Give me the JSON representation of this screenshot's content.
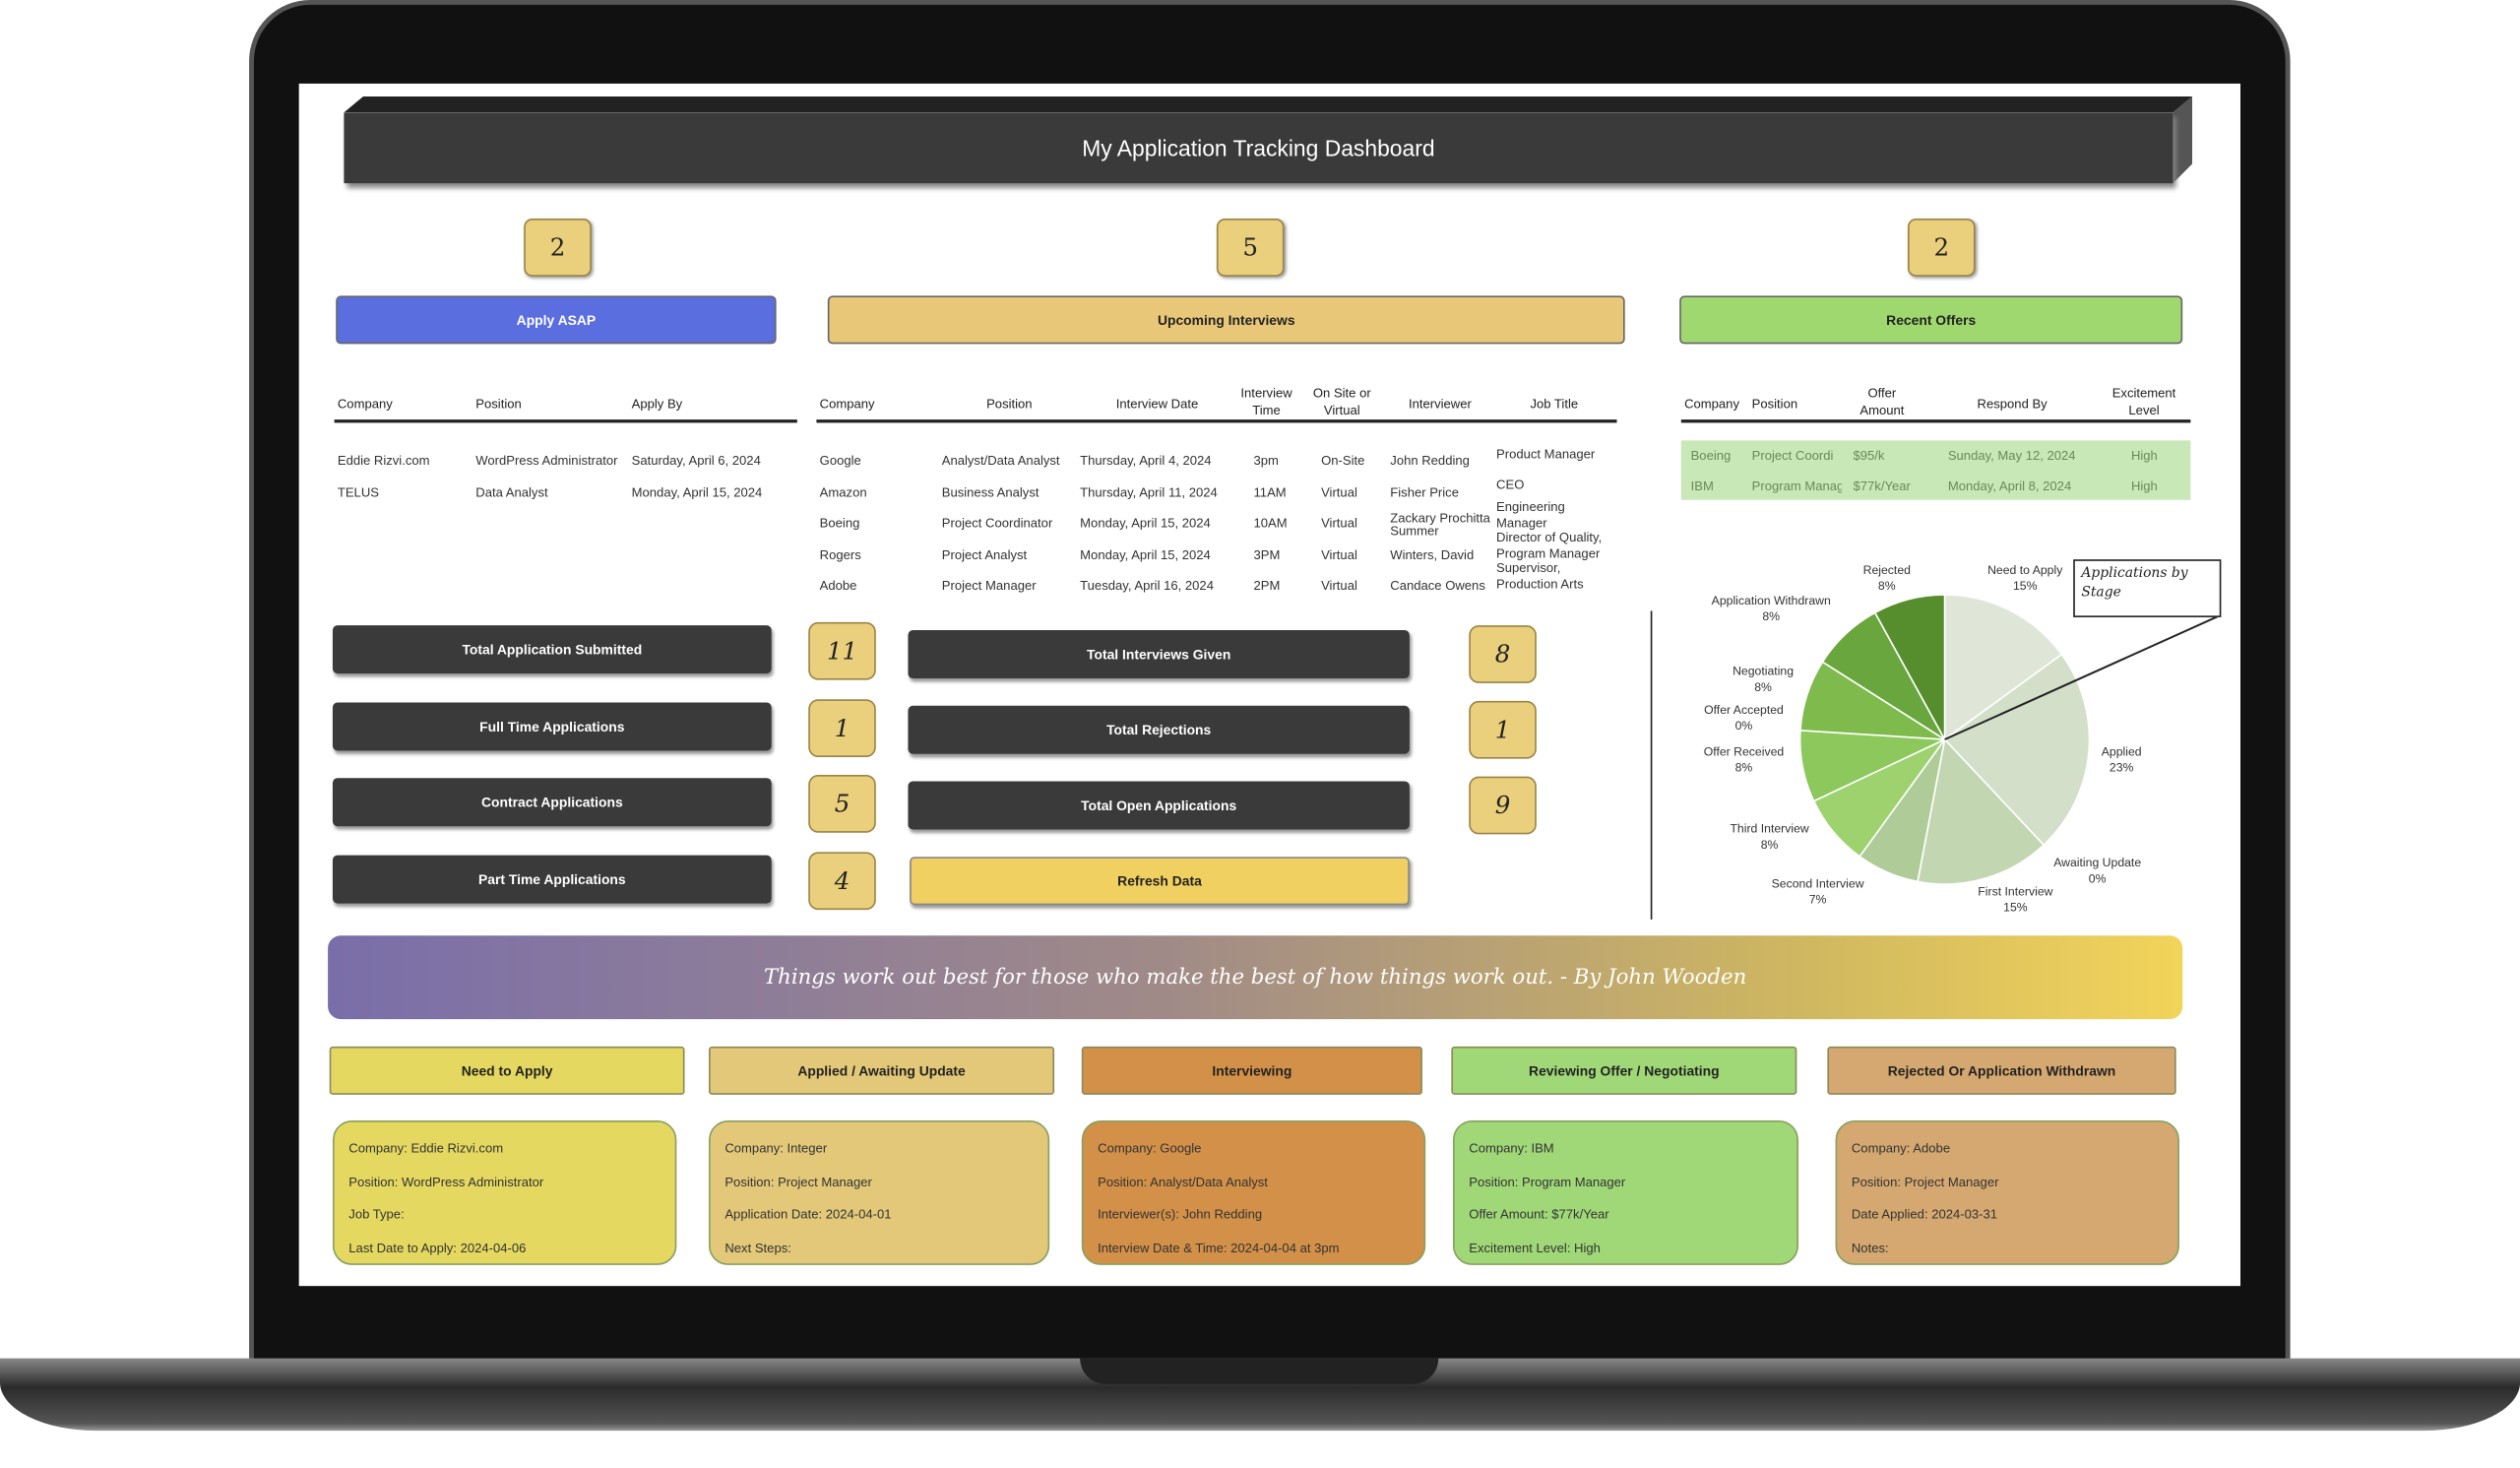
{
  "title": "My Application Tracking Dashboard",
  "counts": {
    "apply_asap": "2",
    "upcoming_interviews": "5",
    "recent_offers": "2"
  },
  "sections": {
    "apply_asap": "Apply ASAP",
    "upcoming_interviews": "Upcoming Interviews",
    "recent_offers": "Recent Offers"
  },
  "apply_table": {
    "headers": [
      "Company",
      "Position",
      "Apply By"
    ],
    "rows": [
      [
        "Eddie Rizvi.com",
        "WordPress Administrator",
        "Saturday, April 6, 2024"
      ],
      [
        "TELUS",
        "Data Analyst",
        "Monday, April 15, 2024"
      ]
    ]
  },
  "interview_table": {
    "headers": [
      "Company",
      "Position",
      "Interview Date",
      "Interview Time",
      "On Site or Virtual",
      "Interviewer",
      "Job Title"
    ],
    "rows": [
      [
        "Google",
        "Analyst/Data Analyst",
        "Thursday, April 4, 2024",
        "3pm",
        "On-Site",
        "John Redding",
        "Product Manager"
      ],
      [
        "Amazon",
        "Business Analyst",
        "Thursday, April 11, 2024",
        "11AM",
        "Virtual",
        "Fisher Price",
        "CEO"
      ],
      [
        "Boeing",
        "Project Coordinator",
        "Monday, April 15, 2024",
        "10AM",
        "Virtual",
        "Zackary Prochitta Summer",
        "Engineering Manager"
      ],
      [
        "Rogers",
        "Project Analyst",
        "Monday, April 15, 2024",
        "3PM",
        "Virtual",
        "Winters, David",
        "Director of Quality, Program Manager"
      ],
      [
        "Adobe",
        "Project Manager",
        "Tuesday, April 16, 2024",
        "2PM",
        "Virtual",
        "Candace Owens",
        "Supervisor, Production Arts"
      ]
    ]
  },
  "offers_table": {
    "headers": [
      "Company",
      "Position",
      "Offer Amount",
      "Respond By",
      "Excitement Level"
    ],
    "rows": [
      [
        "Boeing",
        "Project Coordi",
        "$95/k",
        "Sunday, May 12, 2024",
        "High"
      ],
      [
        "IBM",
        "Program Manag",
        "$77k/Year",
        "Monday, April 8, 2024",
        "High"
      ]
    ]
  },
  "stats_left": [
    {
      "label": "Total Application Submitted",
      "value": "11"
    },
    {
      "label": "Full Time Applications",
      "value": "1"
    },
    {
      "label": "Contract Applications",
      "value": "5"
    },
    {
      "label": "Part Time Applications",
      "value": "4"
    }
  ],
  "stats_right": [
    {
      "label": "Total Interviews Given",
      "value": "8"
    },
    {
      "label": "Total Rejections",
      "value": "1"
    },
    {
      "label": "Total Open Applications",
      "value": "9"
    }
  ],
  "refresh_label": "Refresh Data",
  "quote": "Things work out best for those who make the best of how things work out. - By John Wooden",
  "categories": [
    {
      "label": "Need to Apply",
      "color": "#e4d860",
      "lines": [
        "Company: Eddie Rizvi.com",
        "Position: WordPress Administrator",
        "Job Type:",
        "Last Date to Apply: 2024-04-06"
      ]
    },
    {
      "label": "Applied / Awaiting Update",
      "color": "#e2c878",
      "lines": [
        "Company: Integer",
        "Position: Project Manager",
        "Application Date: 2024-04-01",
        "Next Steps:"
      ]
    },
    {
      "label": "Interviewing",
      "color": "#d29048",
      "lines": [
        "Company: Google",
        "Position: Analyst/Data Analyst",
        "Interviewer(s): John Redding",
        "Interview Date & Time: 2024-04-04 at 3pm"
      ]
    },
    {
      "label": "Reviewing Offer / Negotiating",
      "color": "#a0d878",
      "lines": [
        "Company: IBM",
        "Position: Program Manager",
        "Offer Amount: $77k/Year",
        "Excitement Level: High"
      ]
    },
    {
      "label": "Rejected Or Application Withdrawn",
      "color": "#d4a870",
      "lines": [
        "Company: Adobe",
        "Position: Project Manager",
        "Date Applied: 2024-03-31",
        "Notes:"
      ]
    }
  ],
  "chart_data": {
    "type": "pie",
    "title": "Applications by Stage",
    "unit": "%",
    "slices": [
      {
        "label": "Need to Apply",
        "value": 15,
        "color": "#dfe6d8"
      },
      {
        "label": "Applied",
        "value": 23,
        "color": "#d3dfc8"
      },
      {
        "label": "Awaiting Update",
        "value": 0,
        "color": "#cadab8"
      },
      {
        "label": "First Interview",
        "value": 15,
        "color": "#c3d6b2"
      },
      {
        "label": "Second Interview",
        "value": 7,
        "color": "#aecb98"
      },
      {
        "label": "Third Interview",
        "value": 8,
        "color": "#9ed26e"
      },
      {
        "label": "Offer Received",
        "value": 8,
        "color": "#8cc85c"
      },
      {
        "label": "Offer Accepted",
        "value": 0,
        "color": "#86c456"
      },
      {
        "label": "Negotiating",
        "value": 8,
        "color": "#7eba4c"
      },
      {
        "label": "Application Withdrawn",
        "value": 8,
        "color": "#6aa63e"
      },
      {
        "label": "Rejected",
        "value": 8,
        "color": "#568e2e"
      }
    ]
  }
}
